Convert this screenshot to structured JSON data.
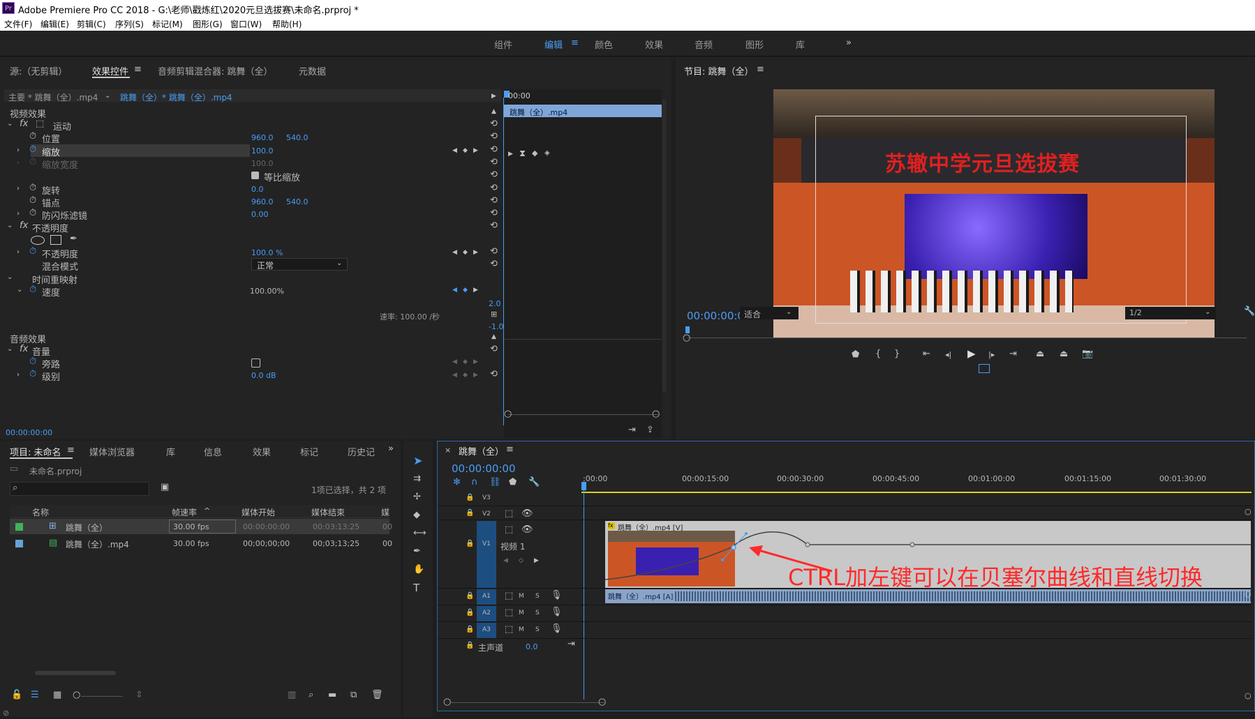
{
  "app": {
    "title": "Adobe Premiere Pro CC 2018 - G:\\老师\\戳炼红\\2020元旦选拔赛\\未命名.prproj *",
    "logo": "Pr"
  },
  "menu": [
    "文件(F)",
    "编辑(E)",
    "剪辑(C)",
    "序列(S)",
    "标记(M)",
    "图形(G)",
    "窗口(W)",
    "帮助(H)"
  ],
  "workspaces": [
    "组件",
    "编辑",
    "颜色",
    "效果",
    "音频",
    "图形",
    "库"
  ],
  "workspace_active": "编辑",
  "workspace_more": "»",
  "effect_panel": {
    "tabs": [
      "源:（无剪辑）",
      "效果控件",
      "音频剪辑混合器: 跳舞（全）",
      "元数据"
    ],
    "active_tab": "效果控件",
    "master_label": "主要 * 跳舞（全）.mp4",
    "clip_label": "跳舞（全）* 跳舞（全）.mp4",
    "mini_timecode": "00:00",
    "mini_clip": "跳舞（全）.mp4",
    "video_effects": "视频效果",
    "motion": "运动",
    "position_label": "位置",
    "position_x": "960.0",
    "position_y": "540.0",
    "scale_label": "缩放",
    "scale_value": "100.0",
    "scale_width_label": "缩放宽度",
    "scale_width_value": "100.0",
    "uniform_scale": "等比缩放",
    "rotation_label": "旋转",
    "rotation_value": "0.0",
    "anchor_label": "锚点",
    "anchor_x": "960.0",
    "anchor_y": "540.0",
    "flicker_label": "防闪烁滤镜",
    "flicker_value": "0.00",
    "opacity_group": "不透明度",
    "opacity_label": "不透明度",
    "opacity_value": "100.0 %",
    "blend_label": "混合模式",
    "blend_value": "正常",
    "time_remap": "时间重映射",
    "speed_label": "速度",
    "speed_value": "100.00%",
    "graph_max": "2.0",
    "graph_min": "-1.0",
    "rate_text": "速率: 100.00 /秒",
    "audio_effects": "音频效果",
    "volume": "音量",
    "bypass_label": "旁路",
    "level_label": "级别",
    "level_value": "0.0 dB",
    "timecode": "00:00:00:00"
  },
  "program": {
    "title": "节目: 跳舞（全）",
    "timecode": "00:00:00:00",
    "fit": "适合",
    "resolution": "1/2",
    "banner_text": "苏辙中学元旦选拔赛"
  },
  "project": {
    "tabs": [
      "项目: 未命名",
      "媒体浏览器",
      "库",
      "信息",
      "效果",
      "标记",
      "历史记"
    ],
    "active_tab": "项目: 未命名",
    "file": "未命名.prproj",
    "selection": "1项已选择，共 2 项",
    "search_placeholder": "",
    "columns": [
      "名称",
      "帧速率",
      "媒体开始",
      "媒体结束",
      "媒"
    ],
    "rows": [
      {
        "color": "#3fb35a",
        "name": "跳舞（全）",
        "fps": "30.00 fps",
        "start": "00:00:00:00",
        "end": "00:03:13:25",
        "extra": "00"
      },
      {
        "color": "#6aa0d8",
        "name": "跳舞（全）.mp4",
        "fps": "30.00 fps",
        "start": "00;00;00;00",
        "end": "00;03;13;25",
        "extra": "00"
      }
    ]
  },
  "timeline": {
    "tab": "跳舞（全）",
    "timecode": "00:00:00:00",
    "ruler": [
      ":00:00",
      "00:00:15:00",
      "00:00:30:00",
      "00:00:45:00",
      "00:01:00:00",
      "00:01:15:00",
      "00:01:30:00"
    ],
    "tracks_video": [
      "V3",
      "V2",
      "V1"
    ],
    "video1_name": "视频 1",
    "tracks_audio": [
      "A1",
      "A2",
      "A3"
    ],
    "master_label": "主声道",
    "master_value": "0.0",
    "video_clip": "跳舞（全）.mp4 [V]",
    "audio_clip": "跳舞（全）.mp4 [A]",
    "annotation": "CTRL加左键可以在贝塞尔曲线和直线切换",
    "m_label": "M",
    "s_label": "S"
  }
}
